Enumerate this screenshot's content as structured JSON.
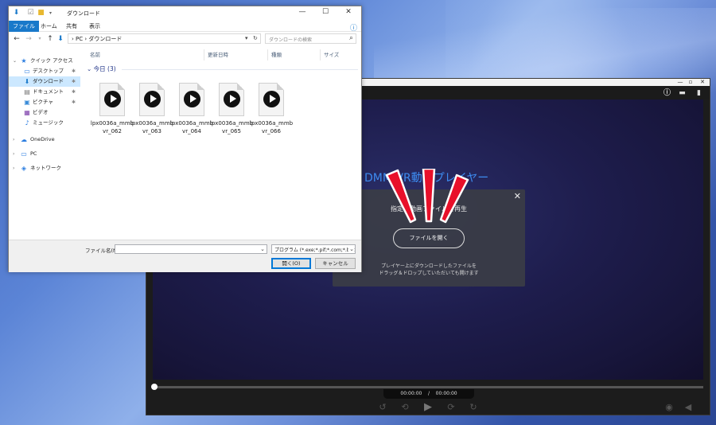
{
  "explorer": {
    "title": "ダウンロード",
    "window_controls": [
      "—",
      "☐",
      "✕"
    ],
    "ribbon_tabs": [
      "ファイル",
      "ホーム",
      "共有",
      "表示"
    ],
    "address_crumbs": "›  PC  ›  ダウンロード",
    "search_placeholder": "ダウンロードの検索",
    "nav_items": [
      {
        "label": "クイック アクセス",
        "icon": "star-icon"
      },
      {
        "label": "デスクトップ",
        "icon": "desktop-icon"
      },
      {
        "label": "ダウンロード",
        "icon": "download-icon"
      },
      {
        "label": "ドキュメント",
        "icon": "document-icon"
      },
      {
        "label": "ピクチャ",
        "icon": "picture-icon"
      },
      {
        "label": "ビデオ",
        "icon": "video-icon"
      },
      {
        "label": "ミュージック",
        "icon": "music-icon"
      },
      {
        "label": "OneDrive",
        "icon": "cloud-icon"
      },
      {
        "label": "PC",
        "icon": "computer-icon"
      },
      {
        "label": "ネットワーク",
        "icon": "network-icon"
      }
    ],
    "columns": [
      "名前",
      "更新日時",
      "種類",
      "サイズ"
    ],
    "group_label": "今日 (3)",
    "files": [
      "lpx0036a_mmbvr_062",
      "lpx0036a_mmbvr_063",
      "lpx0036a_mmbvr_064",
      "lpx0036a_mmbvr_065",
      "lpx0036a_mmbvr_066"
    ],
    "filename_label": "ファイル名(N):",
    "filename_value": "",
    "filetype_value": "プログラム (*.exe;*.pif;*.com;*.bat;",
    "open_label": "開く(O)",
    "cancel_label": "キャンセル"
  },
  "player": {
    "window_controls": [
      "—",
      "▫",
      "✕"
    ],
    "screen_title": "DMM VR動画プレイヤー",
    "dialog": {
      "title": "指定の動画ファイルを再生",
      "open_button": "ファイルを開く",
      "hint_line1": "プレイヤー上にダウンロードしたファイルを",
      "hint_line2": "ドラッグ＆ドロップしていただいても開けます"
    },
    "time_current": "00:00:00",
    "time_separator": "/",
    "time_total": "00:00:00",
    "progress": 0
  },
  "colors": {
    "accent_blue": "#1979ca",
    "selection": "#cce8ff",
    "player_title_blue": "#3d8bf0",
    "exclamation_red": "#e8102a"
  }
}
